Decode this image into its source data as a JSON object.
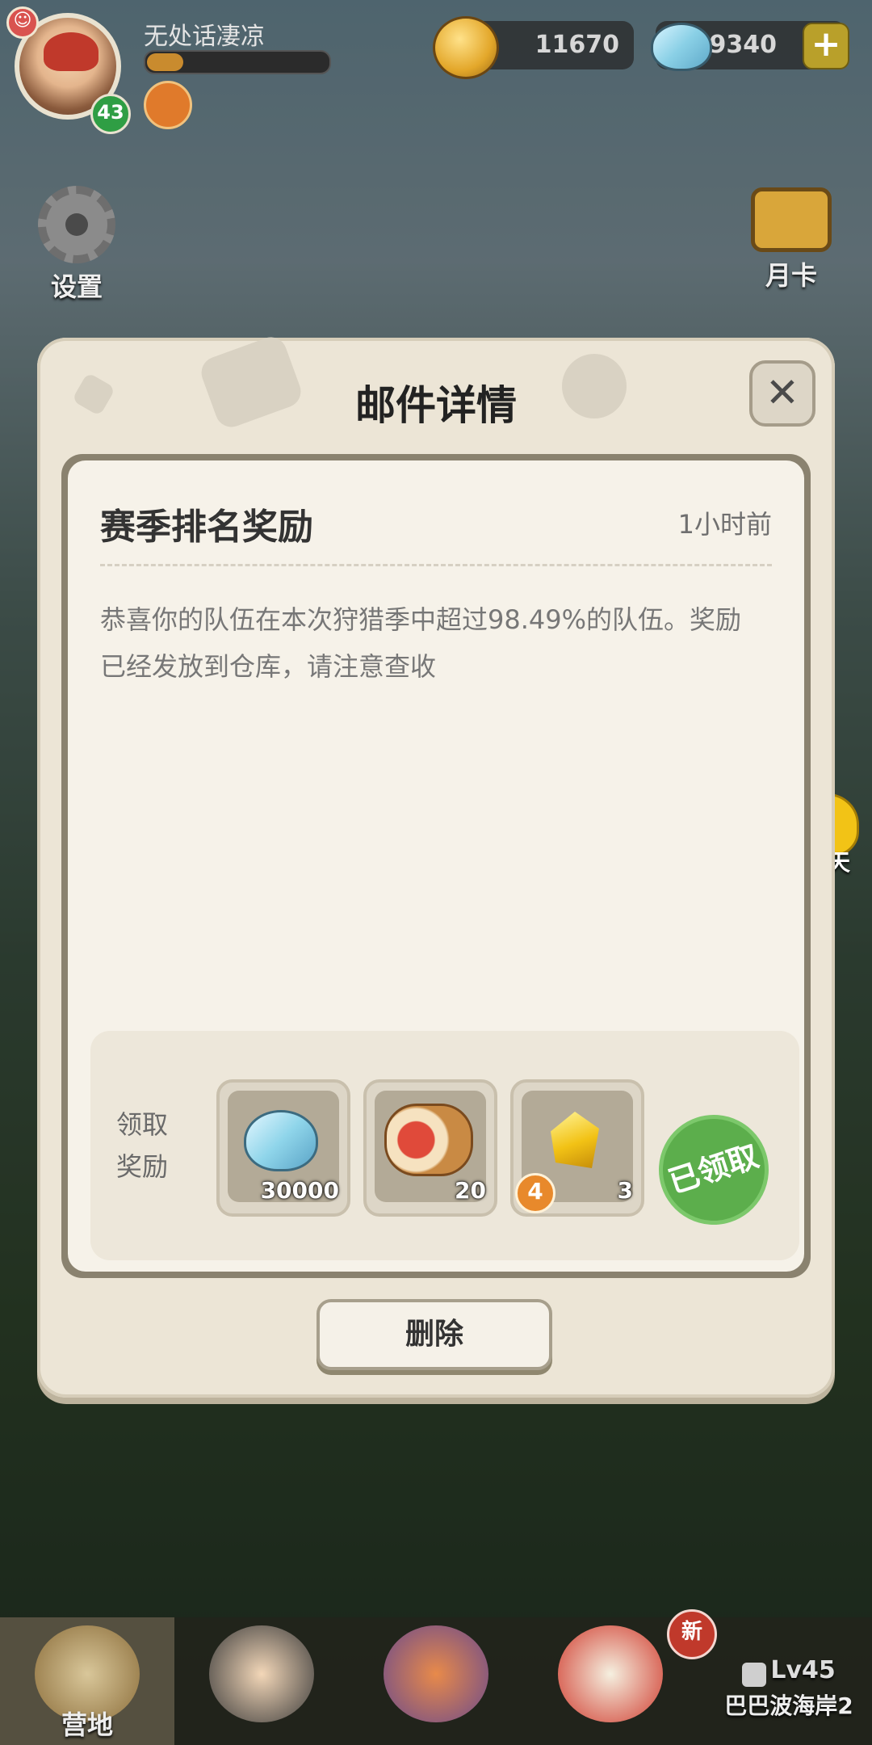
{
  "player": {
    "name": "无处话凄凉",
    "level": "43",
    "xp_fraction": 0.2
  },
  "currencies": {
    "gold": "11670",
    "gems": "49340",
    "add_label": "+"
  },
  "side_buttons": {
    "settings": "设置",
    "month_card": "月卡"
  },
  "dialog": {
    "title": "邮件详情",
    "close_label": "✕",
    "mail": {
      "subject": "赛季排名奖励",
      "time": "1小时前",
      "body": "恭喜你的队伍在本次狩猎季中超过98.49%的队伍。奖励已经发放到仓库，请注意查收"
    },
    "rewards": {
      "label": "领取奖励",
      "items": [
        {
          "icon": "gem-icon",
          "qty": "30000"
        },
        {
          "icon": "meat-icon",
          "qty": "20"
        },
        {
          "icon": "crystal-icon",
          "qty": "3",
          "level": "4"
        }
      ],
      "claimed_label": "已领取"
    },
    "delete_label": "删除"
  },
  "chat": {
    "label": "聊天"
  },
  "bottom_nav": {
    "tabs": [
      {
        "label": "营地"
      },
      {
        "label": ""
      },
      {
        "label": ""
      },
      {
        "label": ""
      }
    ],
    "new_badge": "新",
    "locked": {
      "level": "Lv45",
      "name": "巴巴波海岸2"
    }
  }
}
